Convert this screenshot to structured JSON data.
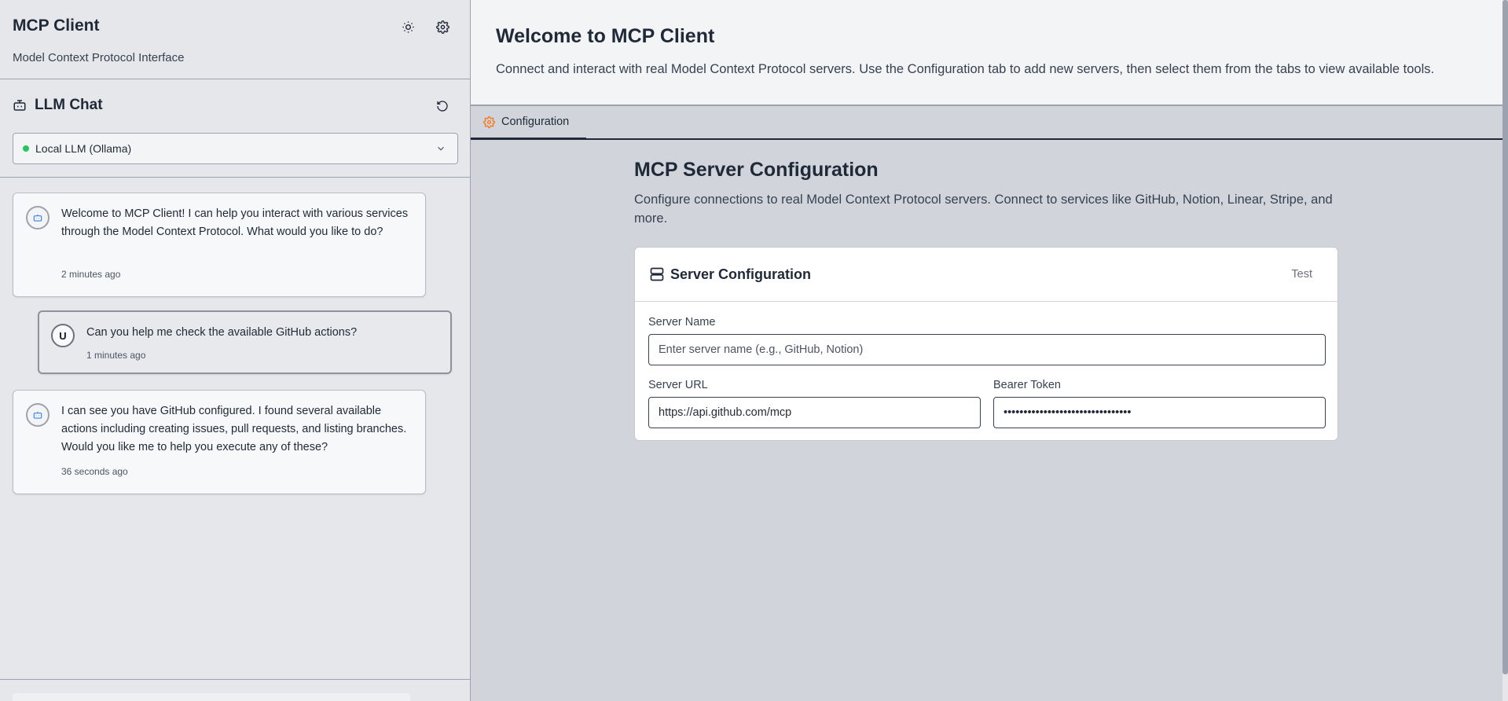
{
  "sidebar": {
    "app_title": "MCP Client",
    "app_subtitle": "Model Context Protocol Interface",
    "theme_icon": "sun-icon",
    "settings_icon": "gear-icon",
    "chat": {
      "title": "LLM Chat",
      "icon": "robot-icon",
      "refresh_icon": "refresh-icon",
      "model_select": {
        "value": "Local LLM (Ollama)",
        "status_color": "#22c55e"
      },
      "messages": [
        {
          "role": "assistant",
          "text": "Welcome to MCP Client! I can help you interact with various services through the Model Context Protocol. What would you like to do?",
          "time": "2 minutes ago"
        },
        {
          "role": "user",
          "avatar_letter": "U",
          "text": "Can you help me check the available GitHub actions?",
          "time": "1 minutes ago"
        },
        {
          "role": "assistant",
          "text": "I can see you have GitHub configured. I found several available actions including creating issues, pull requests, and listing branches. Would you like me to help you execute any of these?",
          "time": "36 seconds ago"
        }
      ]
    }
  },
  "main": {
    "welcome": {
      "title": "Welcome to MCP Client",
      "description": "Connect and interact with real Model Context Protocol servers. Use the Configuration tab to add new servers, then select them from the tabs to view available tools."
    },
    "tabs": [
      {
        "label": "Configuration",
        "icon": "gear-icon",
        "active": true
      }
    ],
    "config": {
      "title": "MCP Server Configuration",
      "description": "Configure connections to real Model Context Protocol servers. Connect to services like GitHub, Notion, Linear, Stripe, and more.",
      "card": {
        "title": "Server Configuration",
        "icon": "server-icon",
        "test_label": "Test",
        "server_name": {
          "label": "Server Name",
          "placeholder": "Enter server name (e.g., GitHub, Notion)",
          "value": ""
        },
        "server_url": {
          "label": "Server URL",
          "value": "https://api.github.com/mcp"
        },
        "bearer_token": {
          "label": "Bearer Token",
          "value": "••••••••••••••••••••••••••••••••"
        }
      }
    }
  },
  "colors": {
    "accent": "#f97316",
    "status_online": "#22c55e",
    "bot_icon": "#3b82f6"
  }
}
